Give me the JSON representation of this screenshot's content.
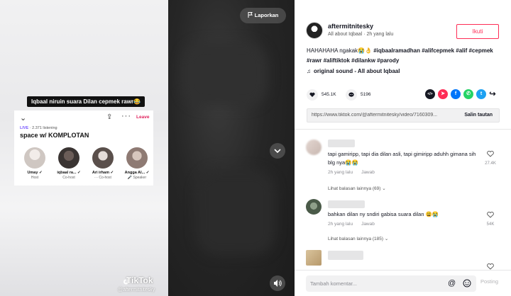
{
  "video": {
    "caption": "Iqbaal niruin suara Dilan cepmek rawr😂",
    "spaces": {
      "leave_label": "Leave",
      "live_label": "LIVE",
      "listening": " · 2.371 listening",
      "title": "space w/ KOMPLOTAN",
      "people": [
        {
          "name": "Umay ✓",
          "role": "Host",
          "avatar_color": "#cfc7c2"
        },
        {
          "name": "iqbaal ra... ✓",
          "role": "Co-host",
          "avatar_color": "#3a3432"
        },
        {
          "name": "Ari irham ✓",
          "role": "··· Co-host",
          "avatar_color": "#5a4f4b"
        },
        {
          "name": "Angga Al... ✓",
          "role": "🎤 Speaker",
          "avatar_color": "#8e7a73"
        }
      ]
    },
    "watermark": {
      "brand": "TikTok",
      "handle": "@aftermitnitesky"
    }
  },
  "overlay": {
    "report_label": "Laporkan",
    "down_icon": "chevron-down-icon",
    "volume_icon": "volume-icon"
  },
  "post": {
    "username": "aftermitnitesky",
    "sound_owner": "All about Iqbaal",
    "time_ago": "2h yang lalu",
    "subtitle": "All about Iqbaal · 2h yang lalu",
    "follow_label": "Ikuti",
    "description_text": "HAHAHAHA ngakak😭👌 ",
    "hashtags": "#iqbaalramadhan #alifcepmek #alif #cepmek #rawr #aliftiktok #dilankw #parody",
    "sound": "original sound - All about Iqbaal",
    "likes": "545.1K",
    "comments": "5196",
    "link": "https://www.tiktok.com/@aftermitnitesky/video/7160309...",
    "copy_label": "Salin tautan",
    "share_icons": [
      {
        "name": "embed-icon",
        "glyph": "</>",
        "color": "#161823"
      },
      {
        "name": "send-icon",
        "glyph": "➤",
        "color": "#fe2c55"
      },
      {
        "name": "facebook-icon",
        "glyph": "f",
        "color": "#0075fa"
      },
      {
        "name": "whatsapp-icon",
        "glyph": "✆",
        "color": "#25d366"
      },
      {
        "name": "twitter-icon",
        "glyph": "t",
        "color": "#1da1f2"
      },
      {
        "name": "share-arrow-icon",
        "glyph": "↪",
        "color": "#161823"
      }
    ]
  },
  "comments": [
    {
      "text": "tapi gamiripp, tapi dia dilan asli, tapi gimiripp aduhh gimana sih blg nya😭😭",
      "time": "2h yang lalu",
      "reply_label": "Jawab",
      "likes": "27.4K",
      "more_replies": "Lihat balasan lainnya (69)",
      "avatar_color": "#d9c9c4"
    },
    {
      "text": "bahkan dilan ny sndiri gabisa suara dilan 😩😭",
      "time": "2h yang lalu",
      "reply_label": "Jawab",
      "likes": "54K",
      "more_replies": "Lihat balasan lainnya (185)",
      "avatar_color": "#4a5a48"
    },
    {
      "text": "",
      "time": "",
      "reply_label": "",
      "likes": "",
      "more_replies": "",
      "avatar_color": "#c9b08a"
    }
  ],
  "footer": {
    "placeholder": "Tambah komentar...",
    "post_label": "Posting"
  }
}
